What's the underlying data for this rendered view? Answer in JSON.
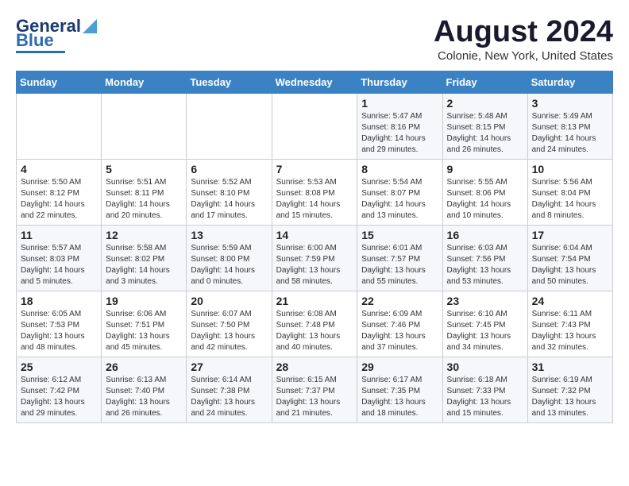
{
  "header": {
    "logo_general": "General",
    "logo_blue": "Blue",
    "title": "August 2024",
    "subtitle": "Colonie, New York, United States"
  },
  "weekdays": [
    "Sunday",
    "Monday",
    "Tuesday",
    "Wednesday",
    "Thursday",
    "Friday",
    "Saturday"
  ],
  "rows": [
    [
      {
        "day": "",
        "info": ""
      },
      {
        "day": "",
        "info": ""
      },
      {
        "day": "",
        "info": ""
      },
      {
        "day": "",
        "info": ""
      },
      {
        "day": "1",
        "info": "Sunrise: 5:47 AM\nSunset: 8:16 PM\nDaylight: 14 hours\nand 29 minutes."
      },
      {
        "day": "2",
        "info": "Sunrise: 5:48 AM\nSunset: 8:15 PM\nDaylight: 14 hours\nand 26 minutes."
      },
      {
        "day": "3",
        "info": "Sunrise: 5:49 AM\nSunset: 8:13 PM\nDaylight: 14 hours\nand 24 minutes."
      }
    ],
    [
      {
        "day": "4",
        "info": "Sunrise: 5:50 AM\nSunset: 8:12 PM\nDaylight: 14 hours\nand 22 minutes."
      },
      {
        "day": "5",
        "info": "Sunrise: 5:51 AM\nSunset: 8:11 PM\nDaylight: 14 hours\nand 20 minutes."
      },
      {
        "day": "6",
        "info": "Sunrise: 5:52 AM\nSunset: 8:10 PM\nDaylight: 14 hours\nand 17 minutes."
      },
      {
        "day": "7",
        "info": "Sunrise: 5:53 AM\nSunset: 8:08 PM\nDaylight: 14 hours\nand 15 minutes."
      },
      {
        "day": "8",
        "info": "Sunrise: 5:54 AM\nSunset: 8:07 PM\nDaylight: 14 hours\nand 13 minutes."
      },
      {
        "day": "9",
        "info": "Sunrise: 5:55 AM\nSunset: 8:06 PM\nDaylight: 14 hours\nand 10 minutes."
      },
      {
        "day": "10",
        "info": "Sunrise: 5:56 AM\nSunset: 8:04 PM\nDaylight: 14 hours\nand 8 minutes."
      }
    ],
    [
      {
        "day": "11",
        "info": "Sunrise: 5:57 AM\nSunset: 8:03 PM\nDaylight: 14 hours\nand 5 minutes."
      },
      {
        "day": "12",
        "info": "Sunrise: 5:58 AM\nSunset: 8:02 PM\nDaylight: 14 hours\nand 3 minutes."
      },
      {
        "day": "13",
        "info": "Sunrise: 5:59 AM\nSunset: 8:00 PM\nDaylight: 14 hours\nand 0 minutes."
      },
      {
        "day": "14",
        "info": "Sunrise: 6:00 AM\nSunset: 7:59 PM\nDaylight: 13 hours\nand 58 minutes."
      },
      {
        "day": "15",
        "info": "Sunrise: 6:01 AM\nSunset: 7:57 PM\nDaylight: 13 hours\nand 55 minutes."
      },
      {
        "day": "16",
        "info": "Sunrise: 6:03 AM\nSunset: 7:56 PM\nDaylight: 13 hours\nand 53 minutes."
      },
      {
        "day": "17",
        "info": "Sunrise: 6:04 AM\nSunset: 7:54 PM\nDaylight: 13 hours\nand 50 minutes."
      }
    ],
    [
      {
        "day": "18",
        "info": "Sunrise: 6:05 AM\nSunset: 7:53 PM\nDaylight: 13 hours\nand 48 minutes."
      },
      {
        "day": "19",
        "info": "Sunrise: 6:06 AM\nSunset: 7:51 PM\nDaylight: 13 hours\nand 45 minutes."
      },
      {
        "day": "20",
        "info": "Sunrise: 6:07 AM\nSunset: 7:50 PM\nDaylight: 13 hours\nand 42 minutes."
      },
      {
        "day": "21",
        "info": "Sunrise: 6:08 AM\nSunset: 7:48 PM\nDaylight: 13 hours\nand 40 minutes."
      },
      {
        "day": "22",
        "info": "Sunrise: 6:09 AM\nSunset: 7:46 PM\nDaylight: 13 hours\nand 37 minutes."
      },
      {
        "day": "23",
        "info": "Sunrise: 6:10 AM\nSunset: 7:45 PM\nDaylight: 13 hours\nand 34 minutes."
      },
      {
        "day": "24",
        "info": "Sunrise: 6:11 AM\nSunset: 7:43 PM\nDaylight: 13 hours\nand 32 minutes."
      }
    ],
    [
      {
        "day": "25",
        "info": "Sunrise: 6:12 AM\nSunset: 7:42 PM\nDaylight: 13 hours\nand 29 minutes."
      },
      {
        "day": "26",
        "info": "Sunrise: 6:13 AM\nSunset: 7:40 PM\nDaylight: 13 hours\nand 26 minutes."
      },
      {
        "day": "27",
        "info": "Sunrise: 6:14 AM\nSunset: 7:38 PM\nDaylight: 13 hours\nand 24 minutes."
      },
      {
        "day": "28",
        "info": "Sunrise: 6:15 AM\nSunset: 7:37 PM\nDaylight: 13 hours\nand 21 minutes."
      },
      {
        "day": "29",
        "info": "Sunrise: 6:17 AM\nSunset: 7:35 PM\nDaylight: 13 hours\nand 18 minutes."
      },
      {
        "day": "30",
        "info": "Sunrise: 6:18 AM\nSunset: 7:33 PM\nDaylight: 13 hours\nand 15 minutes."
      },
      {
        "day": "31",
        "info": "Sunrise: 6:19 AM\nSunset: 7:32 PM\nDaylight: 13 hours\nand 13 minutes."
      }
    ]
  ]
}
